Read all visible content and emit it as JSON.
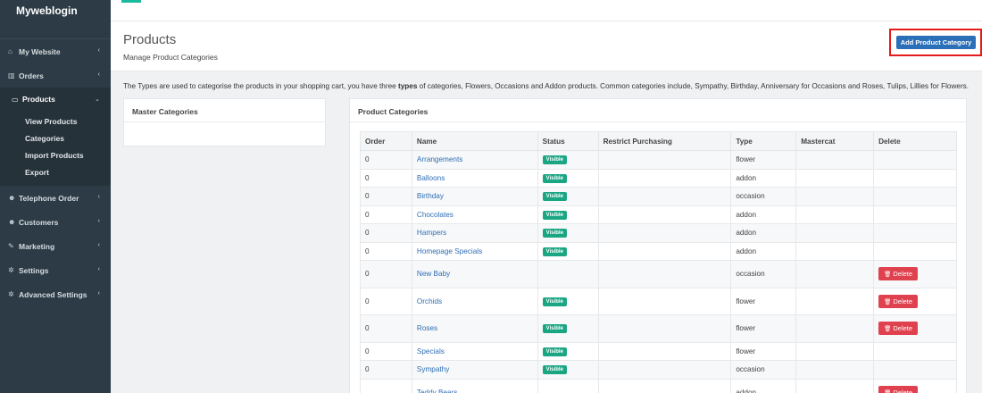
{
  "brand": "Myweblogin",
  "sidebar": {
    "items": [
      {
        "label": "My Website",
        "icon": "home-icon"
      },
      {
        "label": "Orders",
        "icon": "bar-chart-icon"
      },
      {
        "label": "Products",
        "icon": "monitor-icon"
      },
      {
        "label": "Telephone Order",
        "icon": "users-icon"
      },
      {
        "label": "Customers",
        "icon": "users-icon"
      },
      {
        "label": "Marketing",
        "icon": "wrench-icon"
      },
      {
        "label": "Settings",
        "icon": "gear-icon"
      },
      {
        "label": "Advanced Settings",
        "icon": "gears-icon"
      }
    ],
    "products_sub": [
      "View Products",
      "Categories",
      "Import Products",
      "Export"
    ]
  },
  "header": {
    "title": "Products",
    "subtitle": "Manage Product Categories",
    "add_button": "Add Product Category"
  },
  "info": {
    "before": "The Types are used to categorise the products in your shopping cart, you have three ",
    "bold": "types",
    "after": " of categories, Flowers, Occasions and Addon products. Common categories include, Sympathy, Birthday, Anniversary for Occasions and Roses, Tulips, Lillies for Flowers."
  },
  "master_panel": {
    "title": "Master Categories"
  },
  "categories_panel": {
    "title": "Product Categories",
    "columns": [
      "Order",
      "Name",
      "Status",
      "Restrict Purchasing",
      "Type",
      "Mastercat",
      "Delete"
    ],
    "rows": [
      {
        "order": "0",
        "name": "Arrangements",
        "status": "Visible",
        "type": "flower",
        "delete": ""
      },
      {
        "order": "0",
        "name": "Balloons",
        "status": "Visible",
        "type": "addon",
        "delete": ""
      },
      {
        "order": "0",
        "name": "Birthday",
        "status": "Visible",
        "type": "occasion",
        "delete": ""
      },
      {
        "order": "0",
        "name": "Chocolates",
        "status": "Visible",
        "type": "addon",
        "delete": ""
      },
      {
        "order": "0",
        "name": "Hampers",
        "status": "Visible",
        "type": "addon",
        "delete": ""
      },
      {
        "order": "0",
        "name": "Homepage Specials",
        "status": "Visible",
        "type": "addon",
        "delete": ""
      },
      {
        "order": "0",
        "name": "New Baby",
        "status": "",
        "type": "occasion",
        "delete": "Delete"
      },
      {
        "order": "0",
        "name": "Orchids",
        "status": "Visible",
        "type": "flower",
        "delete": "Delete"
      },
      {
        "order": "0",
        "name": "Roses",
        "status": "Visible",
        "type": "flower",
        "delete": "Delete"
      },
      {
        "order": "0",
        "name": "Specials",
        "status": "Visible",
        "type": "flower",
        "delete": ""
      },
      {
        "order": "0",
        "name": "Sympathy",
        "status": "Visible",
        "type": "occasion",
        "delete": ""
      },
      {
        "order": "",
        "name": "Teddy Bears",
        "status": "",
        "type": "addon",
        "delete": "Delete"
      }
    ]
  },
  "colors": {
    "sidebar": "#2c3b45",
    "primary": "#2a6fb8",
    "success": "#1aa583",
    "danger": "#e0414f",
    "highlight": "#e41b1b"
  }
}
